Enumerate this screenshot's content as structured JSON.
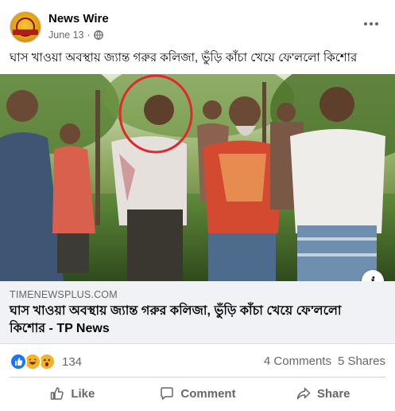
{
  "post": {
    "page_name": "News Wire",
    "date": "June 13",
    "separator": "·",
    "privacy_icon": "globe-icon",
    "more_icon": "more-options-icon",
    "caption": "ঘাস খাওয়া অবস্থায় জ্যান্ত গরুর কলিজা, ভুঁড়ি কাঁচা খেয়ে ফে'ললো কিশোর"
  },
  "link_preview": {
    "domain": "TIMENEWSPLUS.COM",
    "title": "ঘাস খাওয়া অবস্থায় জ্যান্ত গরুর কলিজা, ভুঁড়ি কাঁচা খেয়ে ফে'ললো কিশোর - TP News",
    "info_icon": "info-icon",
    "info_label": "i"
  },
  "stats": {
    "reactions": [
      "like-reaction-icon",
      "haha-reaction-icon",
      "wow-reaction-icon"
    ],
    "reaction_count": "134",
    "comments": "4 Comments",
    "shares": "5 Shares"
  },
  "actions": {
    "like": "Like",
    "comment": "Comment",
    "share": "Share"
  },
  "colors": {
    "primary_text": "#050505",
    "secondary_text": "#65676b",
    "like_blue": "#1877f2",
    "reaction_yellow": "#f7b125",
    "highlight_circle": "#e0282e"
  }
}
